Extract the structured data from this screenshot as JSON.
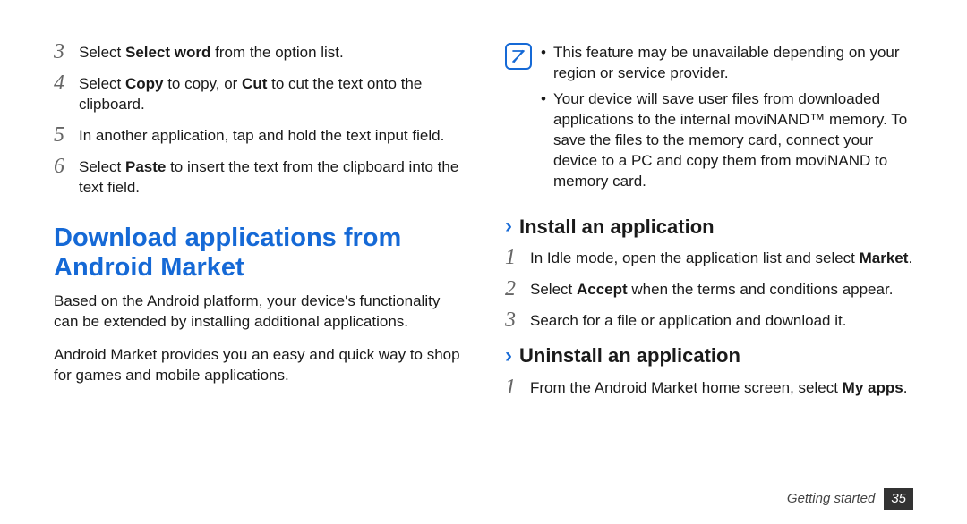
{
  "left": {
    "steps": [
      {
        "num": "3",
        "pre": "Select ",
        "b1": "Select word",
        "post": " from the option list."
      },
      {
        "num": "4",
        "pre": "Select ",
        "b1": "Copy",
        "mid": " to copy, or ",
        "b2": "Cut",
        "post": " to cut the text onto the clipboard."
      },
      {
        "num": "5",
        "text": "In another application, tap and hold the text input field."
      },
      {
        "num": "6",
        "pre": "Select ",
        "b1": "Paste",
        "post": " to insert the text from the clipboard into the text field."
      }
    ],
    "heading": "Download applications from Android Market",
    "p1": "Based on the Android platform, your device's functionality can be extended by installing additional applications.",
    "p2": "Android Market provides you an easy and quick way to shop for games and mobile applications."
  },
  "right": {
    "note": {
      "b1": "This feature may be unavailable depending on your region or service provider.",
      "b2": "Your device will save user files from downloaded applications to the internal moviNAND™ memory. To save the files to the memory card, connect your device to a PC and copy them from moviNAND to memory card."
    },
    "sub1": "Install an application",
    "install": [
      {
        "num": "1",
        "pre": "In Idle mode, open the application list and select ",
        "b1": "Market",
        "post": "."
      },
      {
        "num": "2",
        "pre": "Select ",
        "b1": "Accept",
        "post": " when the terms and conditions appear."
      },
      {
        "num": "3",
        "text": "Search for a file or application and download it."
      }
    ],
    "sub2": "Uninstall an application",
    "uninstall": [
      {
        "num": "1",
        "pre": "From the Android Market home screen, select ",
        "b1": "My apps",
        "post": "."
      }
    ]
  },
  "footer": {
    "section": "Getting started",
    "page": "35"
  }
}
